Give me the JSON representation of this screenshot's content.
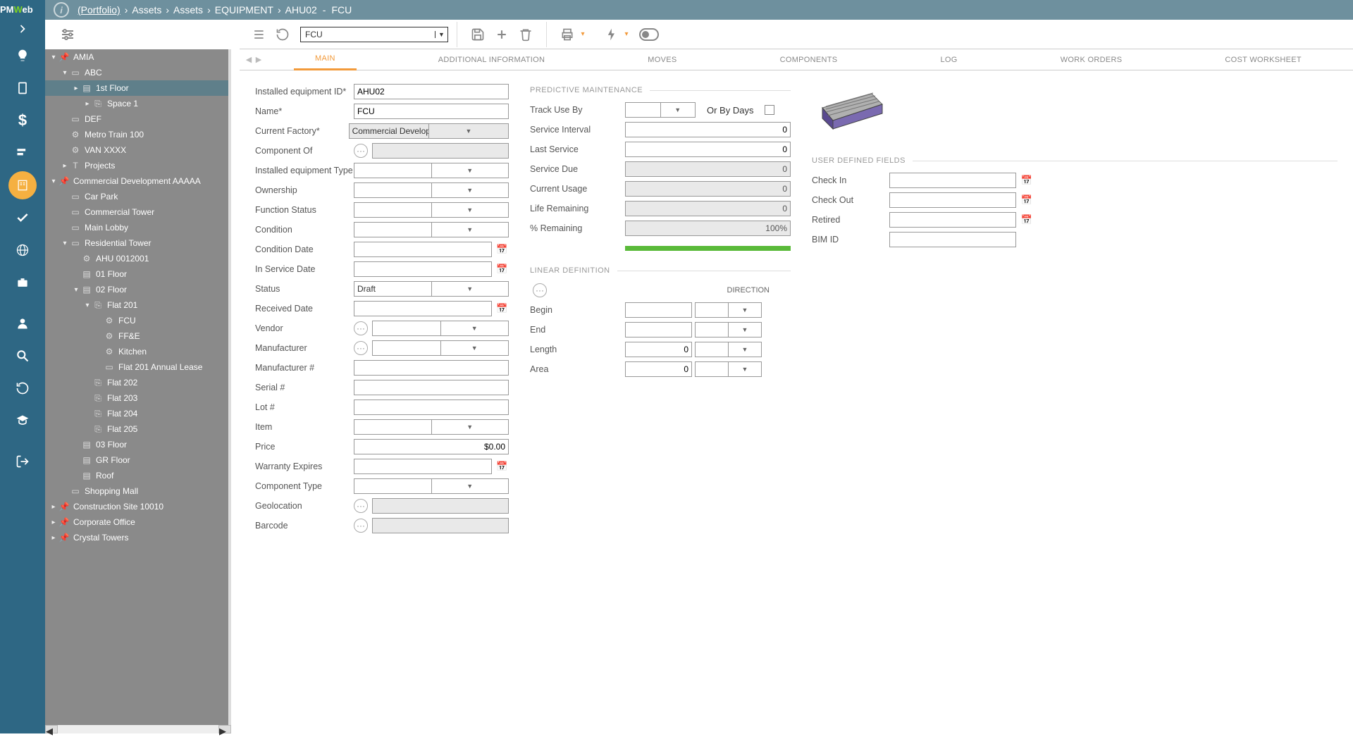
{
  "logo": "PMWeb",
  "breadcrumbs": {
    "portfolio": "(Portfolio)",
    "parts": [
      "Assets",
      "Assets",
      "EQUIPMENT",
      "AHU02"
    ],
    "tail": "FCU"
  },
  "titleCombo": "FCU",
  "tabs": [
    "MAIN",
    "ADDITIONAL INFORMATION",
    "MOVES",
    "COMPONENTS",
    "LOG",
    "WORK ORDERS",
    "COST WORKSHEET"
  ],
  "activeTab": 0,
  "tree": [
    {
      "d": 0,
      "t": "▾",
      "i": "pin",
      "l": "AMIA"
    },
    {
      "d": 1,
      "t": "▾",
      "i": "doc",
      "l": "ABC"
    },
    {
      "d": 2,
      "t": "▸",
      "i": "floor",
      "l": "1st Floor",
      "sel": true
    },
    {
      "d": 3,
      "t": "▸",
      "i": "space",
      "l": "Space 1"
    },
    {
      "d": 1,
      "t": "",
      "i": "doc",
      "l": "DEF"
    },
    {
      "d": 1,
      "t": "",
      "i": "gear",
      "l": "Metro Train 100"
    },
    {
      "d": 1,
      "t": "",
      "i": "gear",
      "l": "VAN XXXX"
    },
    {
      "d": 1,
      "t": "▸",
      "i": "T",
      "l": "Projects"
    },
    {
      "d": 0,
      "t": "▾",
      "i": "pin",
      "l": "Commercial Development AAAAA"
    },
    {
      "d": 1,
      "t": "",
      "i": "doc",
      "l": "Car Park"
    },
    {
      "d": 1,
      "t": "",
      "i": "doc",
      "l": "Commercial Tower"
    },
    {
      "d": 1,
      "t": "",
      "i": "doc",
      "l": "Main Lobby"
    },
    {
      "d": 1,
      "t": "▾",
      "i": "doc",
      "l": "Residential Tower"
    },
    {
      "d": 2,
      "t": "",
      "i": "gear",
      "l": "AHU 0012001"
    },
    {
      "d": 2,
      "t": "",
      "i": "floor",
      "l": "01 Floor"
    },
    {
      "d": 2,
      "t": "▾",
      "i": "floor",
      "l": "02 Floor"
    },
    {
      "d": 3,
      "t": "▾",
      "i": "space",
      "l": "Flat 201"
    },
    {
      "d": 4,
      "t": "",
      "i": "gear",
      "l": "FCU"
    },
    {
      "d": 4,
      "t": "",
      "i": "gear",
      "l": "FF&E"
    },
    {
      "d": 4,
      "t": "",
      "i": "gear",
      "l": "Kitchen"
    },
    {
      "d": 4,
      "t": "",
      "i": "doc",
      "l": "Flat 201 Annual Lease"
    },
    {
      "d": 3,
      "t": "",
      "i": "space",
      "l": "Flat 202"
    },
    {
      "d": 3,
      "t": "",
      "i": "space",
      "l": "Flat 203"
    },
    {
      "d": 3,
      "t": "",
      "i": "space",
      "l": "Flat 204"
    },
    {
      "d": 3,
      "t": "",
      "i": "space",
      "l": "Flat 205"
    },
    {
      "d": 2,
      "t": "",
      "i": "floor",
      "l": "03 Floor"
    },
    {
      "d": 2,
      "t": "",
      "i": "floor",
      "l": "GR Floor"
    },
    {
      "d": 2,
      "t": "",
      "i": "floor",
      "l": "Roof"
    },
    {
      "d": 1,
      "t": "",
      "i": "doc",
      "l": "Shopping Mall"
    },
    {
      "d": 0,
      "t": "▸",
      "i": "pin",
      "l": "Construction Site 10010"
    },
    {
      "d": 0,
      "t": "▸",
      "i": "pin",
      "l": "Corporate Office"
    },
    {
      "d": 0,
      "t": "▸",
      "i": "pin",
      "l": "Crystal Towers"
    }
  ],
  "form": {
    "col1": {
      "id_label": "Installed equipment ID*",
      "id_val": "AHU02",
      "name_label": "Name*",
      "name_val": "FCU",
      "factory_label": "Current Factory*",
      "factory_val": "Commercial Development AAAAA/Re",
      "component_of_label": "Component Of",
      "component_of_val": "",
      "type_label": "Installed equipment Type",
      "type_val": "",
      "own_label": "Ownership",
      "own_val": "",
      "func_label": "Function Status",
      "func_val": "",
      "cond_label": "Condition",
      "cond_val": "",
      "cdate_label": "Condition Date",
      "cdate_val": "",
      "isdate_label": "In Service Date",
      "isdate_val": "",
      "status_label": "Status",
      "status_val": "Draft",
      "rdate_label": "Received Date",
      "rdate_val": "",
      "vendor_label": "Vendor",
      "vendor_val": "",
      "manuf_label": "Manufacturer",
      "manuf_val": "",
      "manufn_label": "Manufacturer #",
      "manufn_val": "",
      "serial_label": "Serial #",
      "serial_val": "",
      "lot_label": "Lot #",
      "lot_val": "",
      "item_label": "Item",
      "item_val": "",
      "price_label": "Price",
      "price_val": "$0.00",
      "warr_label": "Warranty Expires",
      "warr_val": "",
      "ctype_label": "Component Type",
      "ctype_val": "",
      "geo_label": "Geolocation",
      "geo_val": "",
      "barcode_label": "Barcode",
      "barcode_val": ""
    },
    "pm": {
      "title": "PREDICTIVE MAINTENANCE",
      "track_label": "Track Use By",
      "track_val": "",
      "orbydays": "Or By Days",
      "sint_label": "Service Interval",
      "sint_val": "0",
      "last_label": "Last Service",
      "last_val": "0",
      "due_label": "Service Due",
      "due_val": "0",
      "usage_label": "Current Usage",
      "usage_val": "0",
      "life_label": "Life Remaining",
      "life_val": "0",
      "pct_label": "% Remaining",
      "pct_val": "100%",
      "pct_num": 100
    },
    "ld": {
      "title": "LINEAR DEFINITION",
      "direction": "DIRECTION",
      "begin_label": "Begin",
      "end_label": "End",
      "len_label": "Length",
      "len_val": "0",
      "area_label": "Area",
      "area_val": "0"
    },
    "udf": {
      "title": "USER DEFINED FIELDS",
      "ci_label": "Check In",
      "co_label": "Check Out",
      "ret_label": "Retired",
      "bim_label": "BIM ID"
    }
  }
}
